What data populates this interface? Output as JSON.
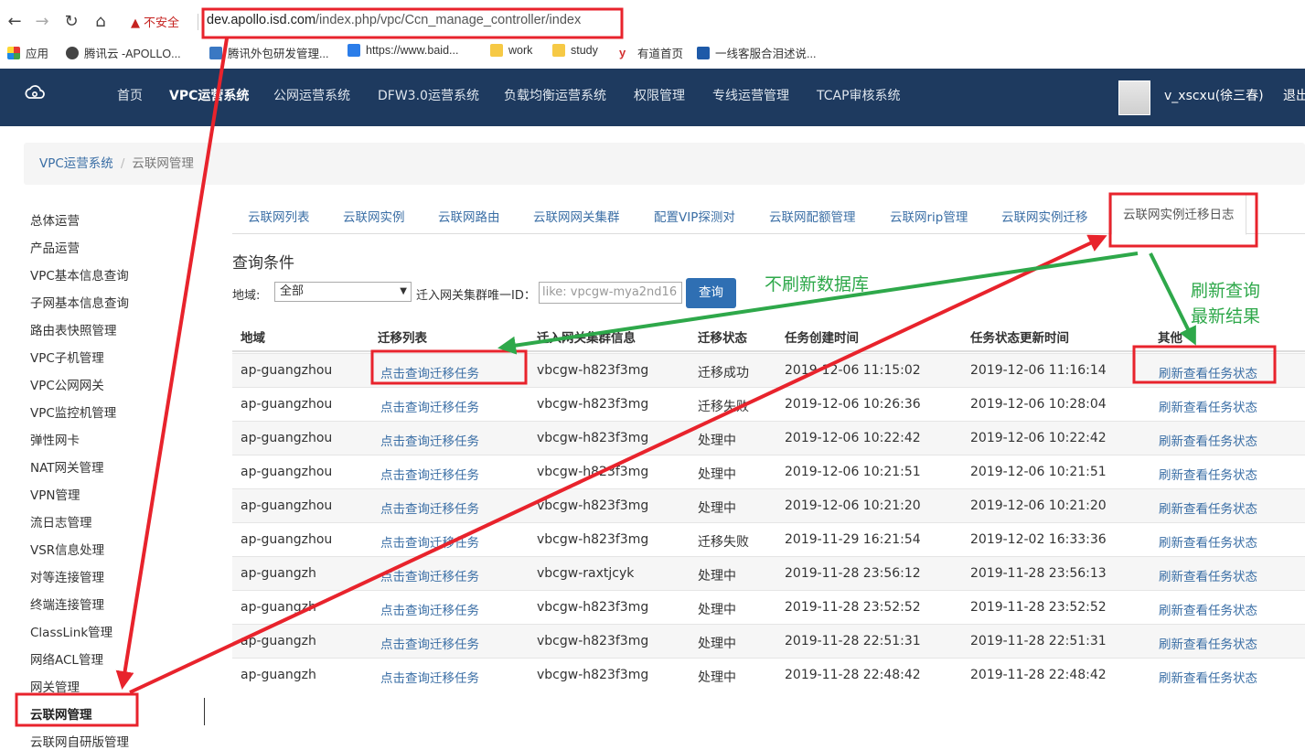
{
  "browser": {
    "warning": "不安全",
    "url_host": "dev.apollo.isd.com",
    "url_path": "/index.php/vpc/Ccn_manage_controller/index",
    "bookmarks": [
      "应用",
      "腾讯云 -APOLLO...",
      "腾讯外包研发管理...",
      "https://www.baid...",
      "work",
      "study",
      "有道首页",
      "一线客服合泪述说..."
    ]
  },
  "topnav": {
    "items": [
      "首页",
      "VPC运营系统",
      "公网运营系统",
      "DFW3.0运营系统",
      "负载均衡运营系统",
      "权限管理",
      "专线运营管理",
      "TCAP审核系统"
    ],
    "username": "v_xscxu(徐三春)",
    "logout": "退出"
  },
  "breadcrumb": {
    "root": "VPC运营系统",
    "separator": "/",
    "current": "云联网管理"
  },
  "sidebar": {
    "items": [
      "总体运营",
      "产品运营",
      "VPC基本信息查询",
      "子网基本信息查询",
      "路由表快照管理",
      "VPC子机管理",
      "VPC公网网关",
      "VPC监控机管理",
      "弹性网卡",
      "NAT网关管理",
      "VPN管理",
      "流日志管理",
      "VSR信息处理",
      "对等连接管理",
      "终端连接管理",
      "ClassLink管理",
      "网络ACL管理",
      "网关管理",
      "云联网管理",
      "云联网自研版管理"
    ],
    "active_index": 18
  },
  "tabs": [
    "云联网列表",
    "云联网实例",
    "云联网路由",
    "云联网网关集群",
    "配置VIP探测对",
    "云联网配额管理",
    "云联网rip管理",
    "云联网实例迁移",
    "云联网实例迁移日志"
  ],
  "query": {
    "title": "查询条件",
    "region_label": "地域:",
    "region_value": "全部",
    "cluster_label": "迁入网关集群唯一ID：",
    "cluster_placeholder": "like: vpcgw-mya2nd16",
    "button": "查询"
  },
  "table": {
    "headers": [
      "地域",
      "迁移列表",
      "迁入网关集群信息",
      "迁移状态",
      "任务创建时间",
      "任务状态更新时间",
      "其他"
    ],
    "rows": [
      [
        "ap-guangzhou",
        "点击查询迁移任务",
        "vbcgw-h823f3mg",
        "迁移成功",
        "2019-12-06 11:15:02",
        "2019-12-06 11:16:14",
        "刷新查看任务状态"
      ],
      [
        "ap-guangzhou",
        "点击查询迁移任务",
        "vbcgw-h823f3mg",
        "迁移失败",
        "2019-12-06 10:26:36",
        "2019-12-06 10:28:04",
        "刷新查看任务状态"
      ],
      [
        "ap-guangzhou",
        "点击查询迁移任务",
        "vbcgw-h823f3mg",
        "处理中",
        "2019-12-06 10:22:42",
        "2019-12-06 10:22:42",
        "刷新查看任务状态"
      ],
      [
        "ap-guangzhou",
        "点击查询迁移任务",
        "vbcgw-h823f3mg",
        "处理中",
        "2019-12-06 10:21:51",
        "2019-12-06 10:21:51",
        "刷新查看任务状态"
      ],
      [
        "ap-guangzhou",
        "点击查询迁移任务",
        "vbcgw-h823f3mg",
        "处理中",
        "2019-12-06 10:21:20",
        "2019-12-06 10:21:20",
        "刷新查看任务状态"
      ],
      [
        "ap-guangzhou",
        "点击查询迁移任务",
        "vbcgw-h823f3mg",
        "迁移失败",
        "2019-11-29 16:21:54",
        "2019-12-02 16:33:36",
        "刷新查看任务状态"
      ],
      [
        "ap-guangzh",
        "点击查询迁移任务",
        "vbcgw-raxtjcyk",
        "处理中",
        "2019-11-28 23:56:12",
        "2019-11-28 23:56:13",
        "刷新查看任务状态"
      ],
      [
        "ap-guangzh",
        "点击查询迁移任务",
        "vbcgw-h823f3mg",
        "处理中",
        "2019-11-28 23:52:52",
        "2019-11-28 23:52:52",
        "刷新查看任务状态"
      ],
      [
        "ap-guangzh",
        "点击查询迁移任务",
        "vbcgw-h823f3mg",
        "处理中",
        "2019-11-28 22:51:31",
        "2019-11-28 22:51:31",
        "刷新查看任务状态"
      ],
      [
        "ap-guangzh",
        "点击查询迁移任务",
        "vbcgw-h823f3mg",
        "处理中",
        "2019-11-28 22:48:42",
        "2019-11-28 22:48:42",
        "刷新查看任务状态"
      ]
    ]
  },
  "annotations": {
    "no_refresh_db": "不刷新数据库",
    "refresh_query_line1": "刷新查询",
    "refresh_query_line2": "最新结果",
    "red": "#e8232c",
    "green": "#2ea84a"
  },
  "colors": {
    "nav_bg": "#1e3a5f",
    "link": "#3a6ea5",
    "button": "#2f6fb3"
  }
}
